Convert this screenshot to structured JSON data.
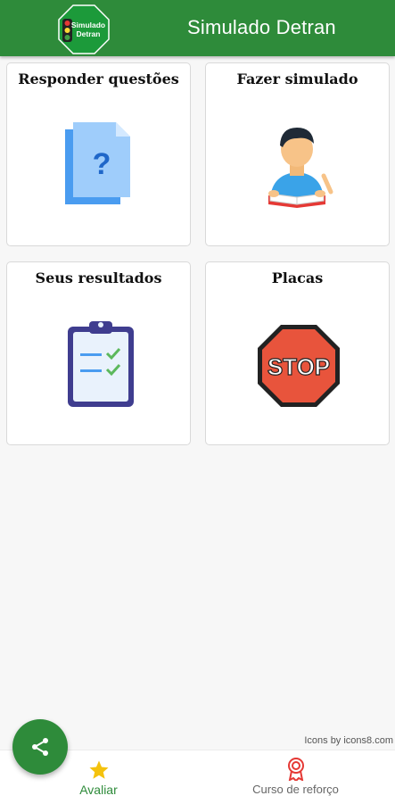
{
  "appbar": {
    "title": "Simulado Detran",
    "logo_text_line1": "Simulado",
    "logo_text_line2": "Detran"
  },
  "cards": [
    {
      "label": "Responder questões",
      "icon": "question-document-icon"
    },
    {
      "label": "Fazer simulado",
      "icon": "student-reading-icon"
    },
    {
      "label": "Seus resultados",
      "icon": "clipboard-checklist-icon"
    },
    {
      "label": "Placas",
      "icon": "stop-sign-icon",
      "sign_text": "STOP"
    }
  ],
  "credit": "Icons by icons8.com",
  "bottom_nav": {
    "items": [
      {
        "label": "Avaliar",
        "icon": "star-icon",
        "active": true
      },
      {
        "label": "Curso de reforço",
        "icon": "award-ribbon-icon",
        "active": false
      }
    ]
  },
  "fab": {
    "icon": "share-icon"
  },
  "colors": {
    "primary": "#2e8b3a",
    "star": "#f4c20d",
    "award": "#e53935"
  }
}
